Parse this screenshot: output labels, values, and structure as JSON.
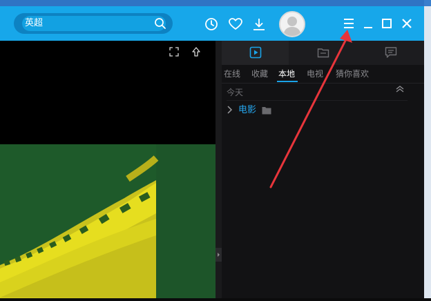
{
  "search": {
    "value": "英超"
  },
  "tabs": {
    "categories": [
      "在线",
      "收藏",
      "本地",
      "电视",
      "猜你喜欢"
    ],
    "active_category": "本地"
  },
  "playlist": {
    "section_label": "今天",
    "folders": [
      {
        "name": "电影"
      }
    ]
  },
  "colors": {
    "titlebar": "#17a7ea",
    "accent": "#1aa3e8",
    "folder_text": "#25a6ee",
    "annotation": "#e8353b"
  },
  "icons": {
    "search": "search-icon",
    "history": "history-icon",
    "favorites": "heart-icon",
    "download": "download-icon",
    "menu": "menu-icon",
    "minimize": "minimize-icon",
    "maximize": "maximize-icon",
    "close": "close-icon"
  }
}
